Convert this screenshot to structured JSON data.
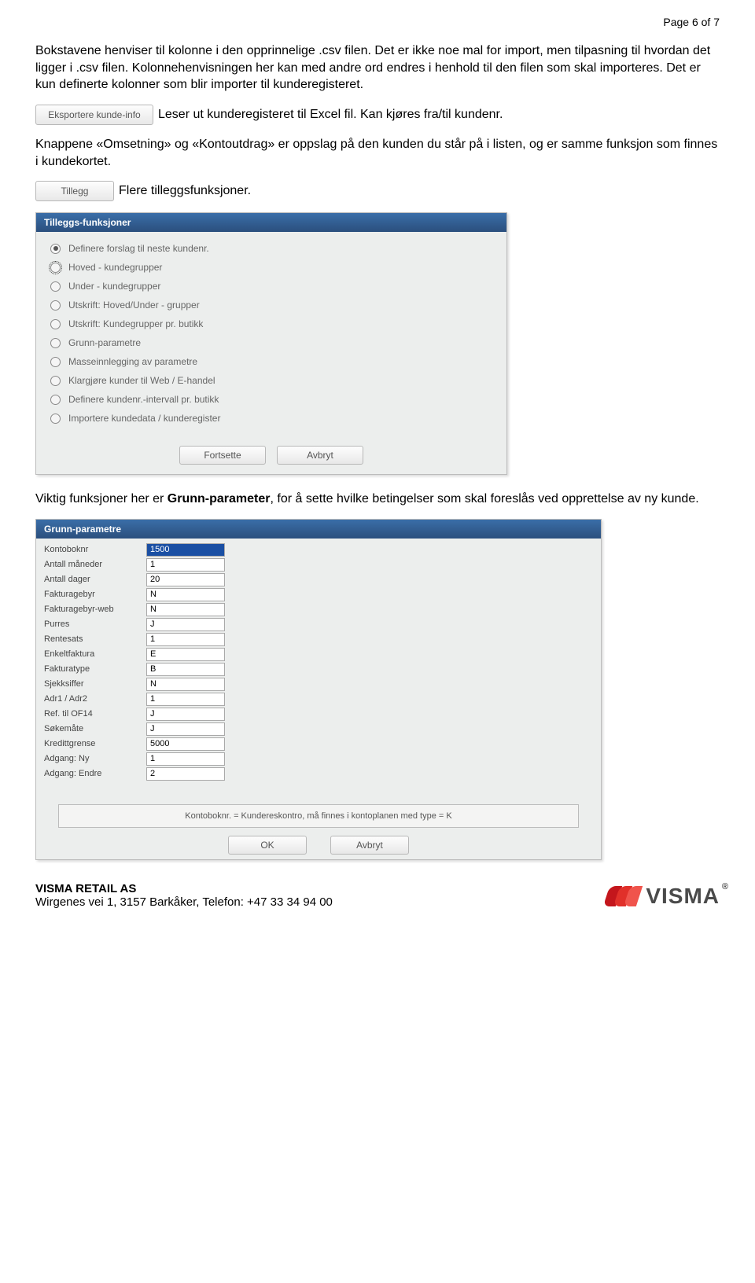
{
  "page_header": "Page 6 of 7",
  "para1": "Bokstavene henviser til kolonne i den opprinnelige .csv filen. Det er ikke noe mal for import, men tilpasning til hvordan det ligger i .csv filen. Kolonnehenvisningen her kan med andre ord endres i henhold til den filen som skal importeres. Det er kun definerte kolonner som blir importer til kunderegisteret.",
  "btn_export": "Eksportere kunde-info",
  "para2": "Leser ut kunderegisteret til Excel fil. Kan kjøres fra/til kundenr.",
  "para3": "Knappene «Omsetning» og «Kontoutdrag» er oppslag på den kunden du står på i listen, og er samme funksjon som finnes i kundekortet.",
  "btn_tillegg": "Tillegg",
  "para4": "Flere tilleggsfunksjoner.",
  "panel1": {
    "title": "Tilleggs-funksjoner",
    "options": [
      "Definere forslag til neste kundenr.",
      "Hoved - kundegrupper",
      "Under - kundegrupper",
      "Utskrift: Hoved/Under - grupper",
      "Utskrift: Kundegrupper pr. butikk",
      "Grunn-parametre",
      "Masseinnlegging av parametre",
      "Klargjøre kunder til Web / E-handel",
      "Definere kundenr.-intervall pr. butikk",
      "Importere kundedata / kunderegister"
    ],
    "ok": "Fortsette",
    "cancel": "Avbryt"
  },
  "para5_pre": "Viktig funksjoner her er ",
  "para5_bold": "Grunn-parameter",
  "para5_post": ", for å sette hvilke betingelser som skal foreslås ved opprettelse av ny kunde.",
  "panel2": {
    "title": "Grunn-parametre",
    "rows": [
      {
        "label": "Kontoboknr",
        "value": "1500",
        "sel": true
      },
      {
        "label": "Antall måneder",
        "value": "1"
      },
      {
        "label": "Antall dager",
        "value": "20"
      },
      {
        "label": "Fakturagebyr",
        "value": "N"
      },
      {
        "label": "Fakturagebyr-web",
        "value": "N"
      },
      {
        "label": "Purres",
        "value": "J"
      },
      {
        "label": "Rentesats",
        "value": "1"
      },
      {
        "label": "Enkeltfaktura",
        "value": "E"
      },
      {
        "label": "Fakturatype",
        "value": "B"
      },
      {
        "label": "Sjekksiffer",
        "value": "N"
      },
      {
        "label": "Adr1 / Adr2",
        "value": "1"
      },
      {
        "label": "Ref. til OF14",
        "value": "J"
      },
      {
        "label": "Søkemåte",
        "value": "J"
      },
      {
        "label": "Kredittgrense",
        "value": "5000"
      },
      {
        "label": "Adgang: Ny",
        "value": "1"
      },
      {
        "label": "Adgang: Endre",
        "value": "2"
      }
    ],
    "note": "Kontoboknr. = Kundereskontro, må finnes i kontoplanen med type = K",
    "ok": "OK",
    "cancel": "Avbryt"
  },
  "footer": {
    "company": "VISMA RETAIL AS",
    "address": "Wirgenes vei 1, 3157 Barkåker, Telefon: +47 33 34 94 00",
    "logo": "VISMA"
  }
}
